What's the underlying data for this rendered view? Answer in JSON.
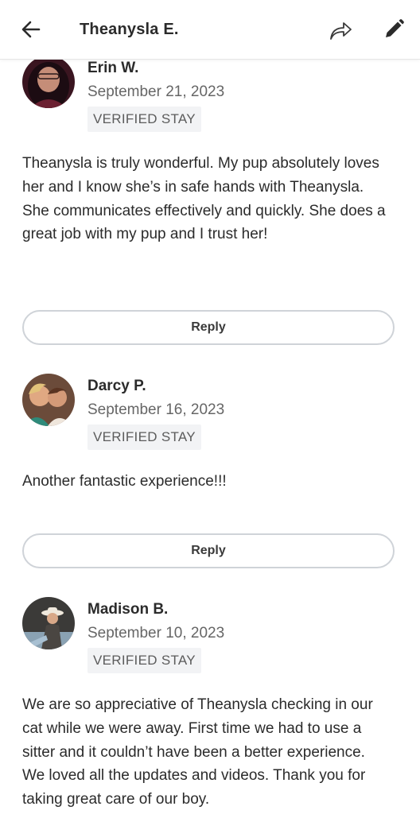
{
  "header": {
    "title": "Theanysla E.",
    "icons": [
      "arrow-left-icon",
      "share-forward-icon",
      "pencil-edit-icon"
    ]
  },
  "reviews": [
    {
      "name": "Erin W.",
      "date": "September 21, 2023",
      "badge": "VERIFIED STAY",
      "text": "Theanysla is truly wonderful. My pup absolutely loves her and I know she’s in safe hands with Theanysla. She communicates effectively and quickly. She does a great job with my pup and I trust her!",
      "reply_label": "Reply"
    },
    {
      "name": "Darcy P.",
      "date": "September 16, 2023",
      "badge": "VERIFIED STAY",
      "text": "Another fantastic experience!!!",
      "reply_label": "Reply"
    },
    {
      "name": "Madison B.",
      "date": "September 10, 2023",
      "badge": "VERIFIED STAY",
      "text": "We are so appreciative of Theanysla checking in our cat while we were away. First time we had to use a sitter and it couldn’t have been a better experience. We loved all the updates and videos. Thank you for taking great care of our boy."
    }
  ],
  "colors": {
    "text": "#2b2b2b",
    "secondary_text": "#666666",
    "badge_bg": "#f2f3f5",
    "button_border": "#cfd3d8"
  }
}
